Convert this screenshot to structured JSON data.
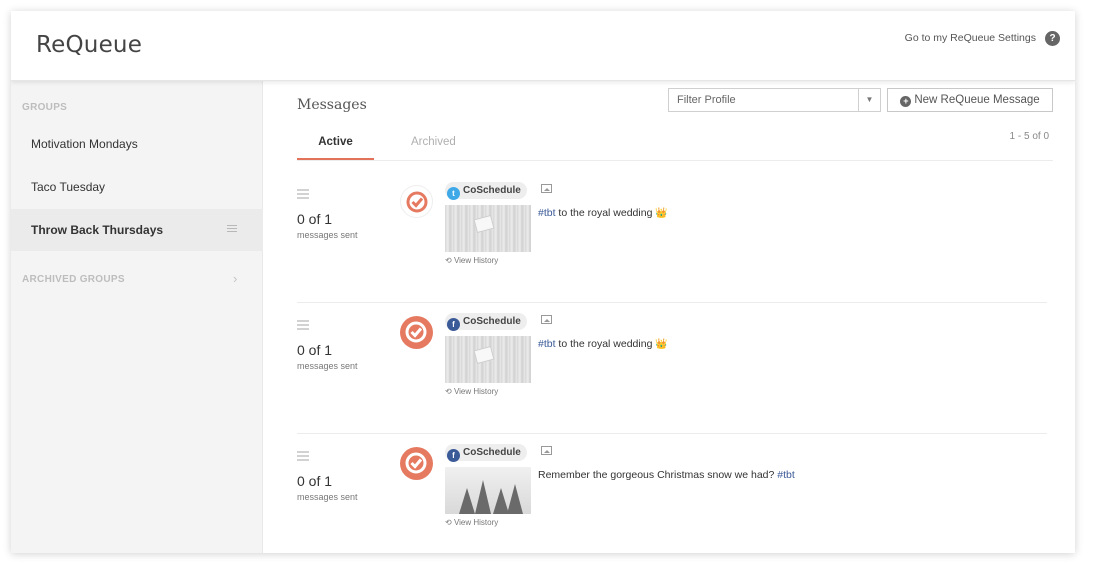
{
  "header": {
    "logo": "ReQueue",
    "settings_link": "Go to my ReQueue Settings",
    "help_icon": "?"
  },
  "sidebar": {
    "groups_heading": "GROUPS",
    "items": [
      {
        "label": "Motivation Mondays"
      },
      {
        "label": "Taco Tuesday"
      },
      {
        "label": "Throw Back Thursdays"
      }
    ],
    "archived_heading": "ARCHIVED GROUPS"
  },
  "main": {
    "title": "Messages",
    "filter_placeholder": "Filter Profile",
    "new_button": "New ReQueue Message",
    "tabs": [
      {
        "label": "Active"
      },
      {
        "label": "Archived"
      }
    ],
    "count": "1 - 5 of 0"
  },
  "messages": [
    {
      "sent": "0 of 1",
      "sent_label": "messages sent",
      "profile": "CoSchedule",
      "network": "twitter",
      "tag": "#tbt",
      "text": " to the royal wedding ",
      "emoji": "👑",
      "history": "View History"
    },
    {
      "sent": "0 of 1",
      "sent_label": "messages sent",
      "profile": "CoSchedule",
      "network": "facebook",
      "tag": "#tbt",
      "text": " to the royal wedding ",
      "emoji": "👑",
      "history": "View History"
    },
    {
      "sent": "0 of 1",
      "sent_label": "messages sent",
      "profile": "CoSchedule",
      "network": "facebook",
      "text": "Remember the gorgeous Christmas snow we had? ",
      "tag": "#tbt",
      "history": "View History"
    }
  ],
  "colors": {
    "accent": "#e2735a",
    "twitter": "#3fa9e8",
    "facebook": "#3b5a98"
  }
}
